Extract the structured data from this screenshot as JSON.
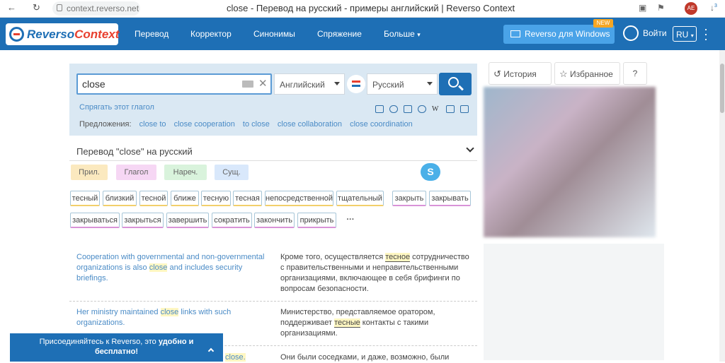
{
  "browser": {
    "url": "context.reverso.net",
    "tab_title": "close - Перевод на русский - примеры английский | Reverso Context",
    "ext_badge": "AE",
    "ext_count": "3"
  },
  "header": {
    "logo_reverso": "Reverso",
    "logo_context": "Context",
    "nav": [
      "Перевод",
      "Корректор",
      "Синонимы",
      "Спряжение",
      "Больше"
    ],
    "windows_button": "Reverso для Windows",
    "new_badge": "NEW",
    "login": "Войти",
    "lang": "RU"
  },
  "search": {
    "query": "close",
    "source_lang": "Английский",
    "target_lang": "Русский",
    "conjugate_link": "Спрягать этот глагол",
    "suggestions_label": "Предложения:",
    "suggestions": [
      "close to",
      "close cooperation",
      "to close",
      "close collaboration",
      "close coordination"
    ]
  },
  "translation": {
    "heading": "Перевод \"close\" на русский",
    "pos": [
      "Прил.",
      "Глагол",
      "Нареч.",
      "Сущ."
    ],
    "pos_colors": [
      "#fbe9bf",
      "#f6d7f4",
      "#d9f3dc",
      "#d9e8fb"
    ],
    "adj_tags": [
      "тесный",
      "близкий",
      "тесной",
      "ближе",
      "тесную",
      "тесная",
      "непосредственной",
      "тщательный"
    ],
    "verb_tags": [
      "закрыть",
      "закрывать",
      "закрываться",
      "закрыться",
      "завершить",
      "сократить",
      "закончить",
      "прикрыть"
    ],
    "more": "···",
    "skype": "S"
  },
  "examples": [
    {
      "src_before": "Cooperation with governmental and non-governmental organizations is also ",
      "src_hl": "close",
      "src_after": " and includes security briefings.",
      "tgt_before": "Кроме того, осуществляется ",
      "tgt_hl": "тесное",
      "tgt_after": " сотрудничество с правительственными и неправительственными организациями, включающее в себя брифинги по вопросам безопасности."
    },
    {
      "src_before": "Her ministry maintained ",
      "src_hl": "close",
      "src_after": " links with such organizations.",
      "tgt_before": "Министерство, представляемое оратором, поддерживает ",
      "tgt_hl": "тесные",
      "tgt_after": " контакты с такими организациями."
    },
    {
      "src_before": "",
      "src_hl": "close.",
      "src_after": "",
      "tgt_before": "Они были соседками, и даже, возможно, были",
      "tgt_hl": "",
      "tgt_after": ""
    }
  ],
  "sidebar": {
    "history": "История",
    "favorites": "Избранное"
  },
  "join_banner": {
    "text_before": "Присоединяйтесь к Reverso, это ",
    "text_bold": "удобно и бесплатно!"
  }
}
